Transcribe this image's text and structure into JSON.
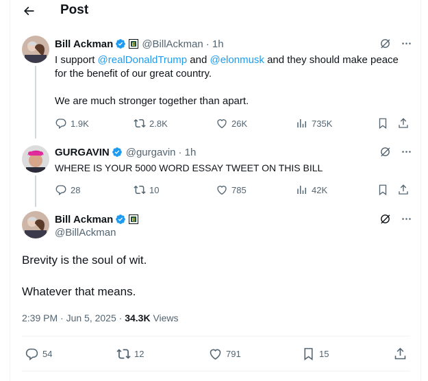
{
  "header": {
    "title": "Post"
  },
  "tweets": [
    {
      "name": "Bill Ackman",
      "handle": "@BillAckman",
      "time": "· 1h",
      "text_parts": [
        "I support ",
        "@realDonaldTrump",
        " and ",
        "@elonmusk",
        " and they should make peace for the benefit of our great country."
      ],
      "text_2": "We are much stronger together than apart.",
      "replies": "1.9K",
      "reposts": "2.8K",
      "likes": "26K",
      "views": "735K"
    },
    {
      "name": "GURGAVIN",
      "handle": "@gurgavin",
      "time": "· 1h",
      "text": "WHERE IS YOUR 5000 WORD ESSAY TWEET ON THIS BILL",
      "replies": "28",
      "reposts": "10",
      "likes": "785",
      "views": "42K"
    }
  ],
  "main": {
    "name": "Bill Ackman",
    "handle": "@BillAckman",
    "line1": "Brevity is the soul of wit.",
    "line2": "Whatever that means.",
    "timestamp": "2:39 PM · Jun 5, 2025 · ",
    "views_count": "34.3K",
    "views_label": " Views",
    "replies": "54",
    "reposts": "12",
    "likes": "791",
    "bookmarks": "15"
  },
  "colors": {
    "accent": "#1d9bf0",
    "muted": "#536471",
    "text": "#0f1419",
    "border": "#eff3f4"
  }
}
